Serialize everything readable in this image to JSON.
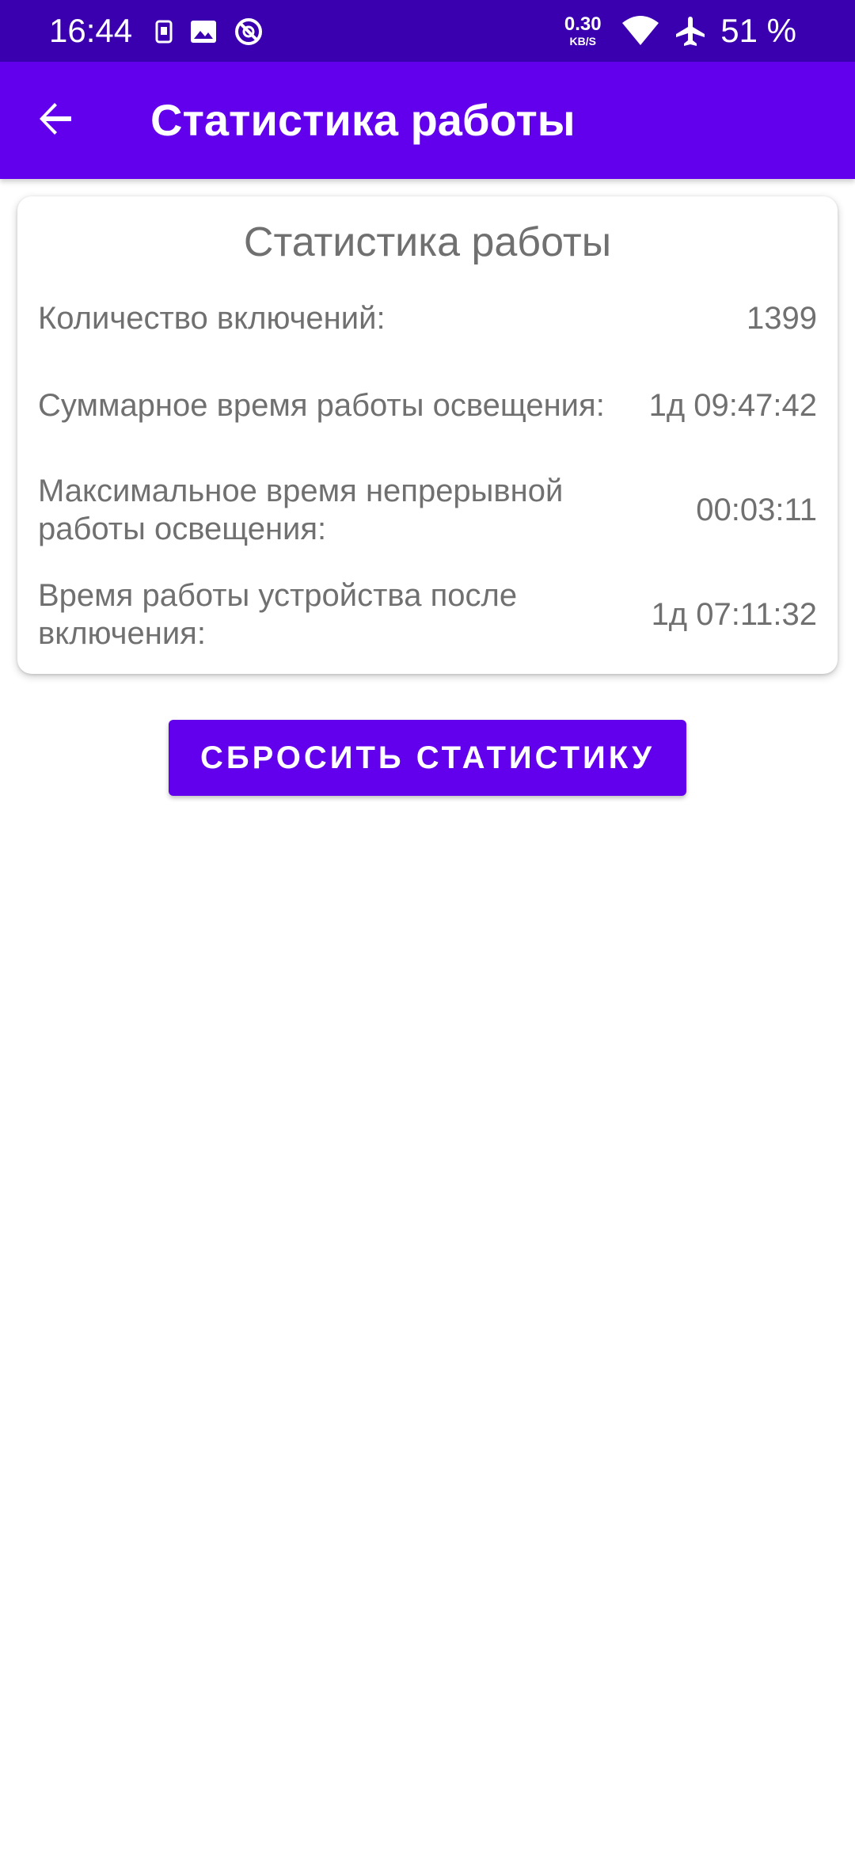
{
  "status_bar": {
    "time": "16:44",
    "left_icons": [
      "sim-card-icon",
      "image-icon",
      "no-disturb-icon"
    ],
    "net_speed_value": "0.30",
    "net_speed_unit": "KB/S",
    "right_icons": [
      "wifi-icon",
      "airplane-icon"
    ],
    "battery": "51 %"
  },
  "app_bar": {
    "back_icon": "arrow-left-icon",
    "title": "Статистика работы"
  },
  "card": {
    "title": "Статистика работы",
    "rows": [
      {
        "label": "Количество включений:",
        "value": "1399"
      },
      {
        "label": "Суммарное время работы освещения:",
        "value": "1д 09:47:42"
      },
      {
        "label": "Максимальное время непрерывной работы освещения:",
        "value": "00:03:11"
      },
      {
        "label": "Время работы устройства после включения:",
        "value": "1д 07:11:32"
      }
    ]
  },
  "reset_button": {
    "label": "СБРОСИТЬ СТАТИСТИКУ"
  },
  "colors": {
    "status_bar": "#3a00b0",
    "primary": "#6200ee",
    "text_secondary": "#707070",
    "on_primary": "#ffffff"
  }
}
